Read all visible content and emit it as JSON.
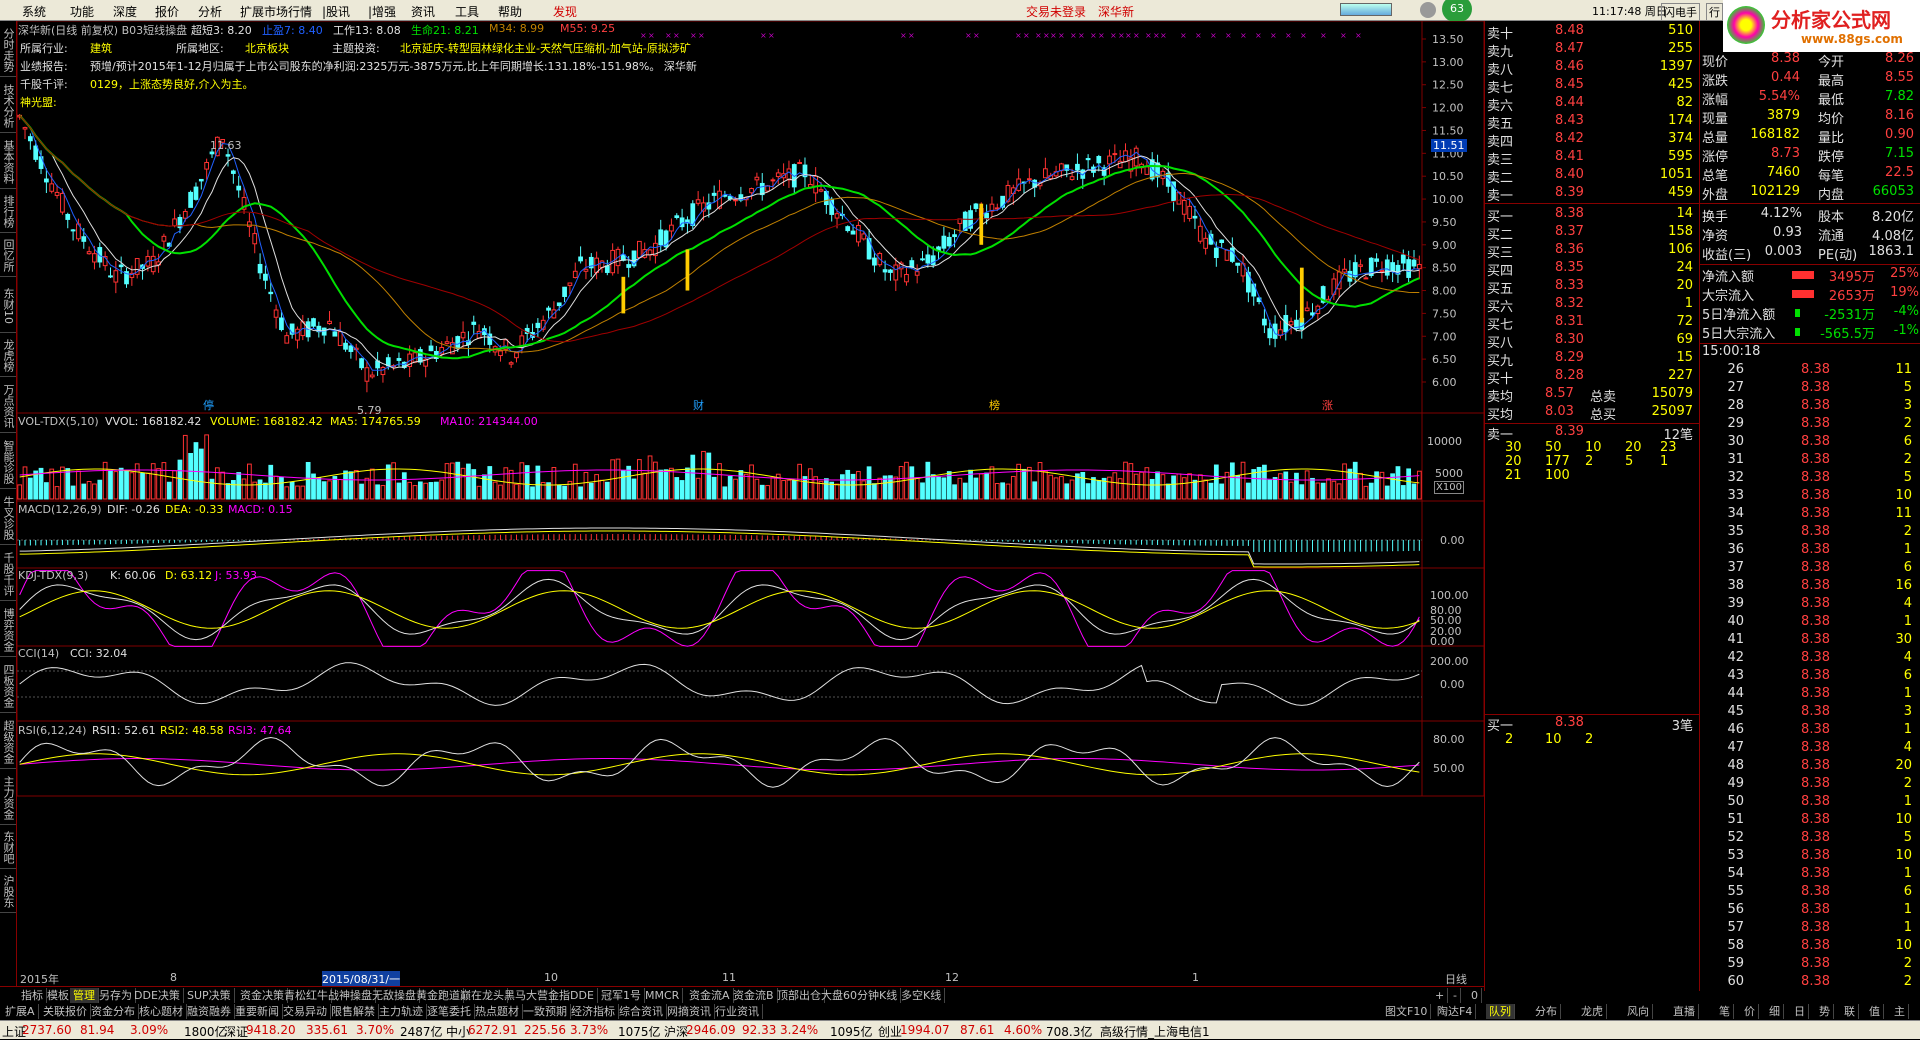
{
  "menu": [
    "系统",
    "功能",
    "深度",
    "报价",
    "分析",
    "扩展市场行情",
    "|股讯",
    "|增强",
    "资讯",
    "工具",
    "帮助",
    "发现"
  ],
  "login_text": "交易未登录",
  "login_stock": "深华新",
  "badge": "63",
  "clock": "11:17:48 周日",
  "server": "闪电手",
  "logo_text": "分析家公式网",
  "logo_url": "www.88gs.com",
  "chart_header": {
    "name": "深华新(日线 前复权) B03短线操盘",
    "c1": "超短3: 8.20",
    "c2": "止盈7: 8.40",
    "c3": "工作13: 8.08",
    "c4": "生命21: 8.21",
    "c5": "M34: 8.99",
    "c6": "M55: 9.25"
  },
  "info": {
    "industry_label": "所属行业:",
    "industry": "建筑",
    "region_label": "所属地区:",
    "region": "北京板块",
    "theme_label": "主题投资:",
    "theme": "北京延庆-转型园林绿化主业-天然气压缩机-加气站-原拟涉矿",
    "report_label": "业绩报告:",
    "report": "预增/预计2015年1-12月归属于上市公司股东的净利润:2325万元-3875万元,比上年同期增长:131.18%-151.98%。 深华新",
    "comment_label": "千股千评:",
    "comment": "0129，上涨态势良好,介入为主。",
    "alliance_label": "神光盟:"
  },
  "price_marks": {
    "high": "11.63",
    "low": "5.79",
    "current": "11.51"
  },
  "event_marks": [
    "停",
    "财",
    "榜",
    "涨"
  ],
  "price_axis": [
    "13.50",
    "13.00",
    "12.50",
    "12.00",
    "11.50",
    "11.00",
    "10.50",
    "10.00",
    "9.50",
    "9.00",
    "8.50",
    "8.00",
    "7.50",
    "7.00",
    "6.50",
    "6.00"
  ],
  "vol": {
    "title": "VOL-TDX(5,10)",
    "vvol": "VVOL: 168182.42",
    "volume": "VOLUME: 168182.42",
    "ma5": "MA5: 174765.59",
    "ma10": "MA10: 214344.00",
    "axis": [
      "10000",
      "5000"
    ],
    "unit": "X100"
  },
  "macd": {
    "title": "MACD(12,26,9)",
    "dif": "DIF: -0.26",
    "dea": "DEA: -0.33",
    "macd": "MACD: 0.15",
    "axis": "0.00"
  },
  "kdj": {
    "title": "KDJ-TDX(9,3)",
    "k": "K: 60.06",
    "d": "D: 63.12",
    "j": "J: 53.93",
    "axis": [
      "100.00",
      "80.00",
      "50.00",
      "20.00",
      "0.00"
    ]
  },
  "cci": {
    "title": "CCI(14)",
    "v": "CCI: 32.04",
    "axis": [
      "200.00",
      "0.00"
    ]
  },
  "rsi": {
    "title": "RSI(6,12,24)",
    "r1": "RSI1: 52.61",
    "r2": "RSI2: 48.58",
    "r3": "RSI3: 47.64",
    "axis": [
      "80.00",
      "50.00"
    ]
  },
  "date_axis": [
    "2015年",
    "8",
    "2015/08/31/一",
    "10",
    "11",
    "12",
    "1"
  ],
  "period": "日线",
  "left_tabs": [
    "分时走势",
    "技术分析",
    "基本资料",
    "排行榜",
    "回忆所",
    "东财10",
    "龙虎榜",
    "万点资讯",
    "智能诊股",
    "牛叉诊股",
    "千股千评",
    "博弈资金",
    "四板资金",
    "超级资金",
    "主力资金",
    "东财吧",
    "沪股东"
  ],
  "tabs1": [
    "指标",
    "模板",
    "管理",
    "另存为",
    "DDE决策",
    "SUP决策",
    "资金决策",
    "青松红牛",
    "战神操盘",
    "无敌操盘",
    "黄金跑道",
    "巅在龙头",
    "黑马大营",
    "金指DDE",
    "冠军1号",
    "MMCR",
    "资金流A",
    "资金流B",
    "顶部出仓",
    "大盘60分钟K线",
    "多空K线"
  ],
  "tabs2": [
    "扩展A",
    "关联报价",
    "资金分布",
    "核心题材",
    "融资融券",
    "重要新闻",
    "交易异动",
    "限售解禁",
    "主力轨迹",
    "逐笔委托",
    "热点题材",
    "一致预期",
    "经济指标",
    "综合资讯",
    "网摘资讯",
    "行业资讯"
  ],
  "tabs2_right": [
    "图文F10",
    "陶达F4"
  ],
  "ask": [
    [
      "卖十",
      "8.48",
      "510"
    ],
    [
      "卖九",
      "8.47",
      "255"
    ],
    [
      "卖八",
      "8.46",
      "1397"
    ],
    [
      "卖七",
      "8.45",
      "425"
    ],
    [
      "卖六",
      "8.44",
      "82"
    ],
    [
      "卖五",
      "8.43",
      "174"
    ],
    [
      "卖四",
      "8.42",
      "374"
    ],
    [
      "卖三",
      "8.41",
      "595"
    ],
    [
      "卖二",
      "8.40",
      "1051"
    ],
    [
      "卖一",
      "8.39",
      "459"
    ]
  ],
  "bid": [
    [
      "买一",
      "8.38",
      "14"
    ],
    [
      "买二",
      "8.37",
      "158"
    ],
    [
      "买三",
      "8.36",
      "106"
    ],
    [
      "买四",
      "8.35",
      "24"
    ],
    [
      "买五",
      "8.33",
      "20"
    ],
    [
      "买六",
      "8.32",
      "1"
    ],
    [
      "买七",
      "8.31",
      "72"
    ],
    [
      "买八",
      "8.30",
      "69"
    ],
    [
      "买九",
      "8.29",
      "15"
    ],
    [
      "买十",
      "8.28",
      "227"
    ]
  ],
  "avg": {
    "ask_avg_l": "卖均",
    "ask_avg": "8.57",
    "tot_ask_l": "总卖",
    "tot_ask": "15079",
    "bid_avg_l": "买均",
    "bid_avg": "8.03",
    "tot_bid_l": "总买",
    "tot_bid": "25097"
  },
  "queue_sell": {
    "label": "卖一",
    "price": "8.39",
    "count": "12笔",
    "row1": [
      "30",
      "50",
      "10",
      "20",
      "23"
    ],
    "row2": [
      "20",
      "177",
      "2",
      "5",
      "1"
    ],
    "row3": [
      "21",
      "100"
    ]
  },
  "queue_buy": {
    "label": "买一",
    "price": "8.38",
    "count": "3笔",
    "row1": [
      "2",
      "10",
      "2"
    ]
  },
  "stats": [
    [
      "现价",
      "8.38",
      "今开",
      "8.26"
    ],
    [
      "涨跌",
      "0.44",
      "最高",
      "8.55"
    ],
    [
      "涨幅",
      "5.54%",
      "最低",
      "7.82"
    ],
    [
      "现量",
      "3879",
      "均价",
      "8.16"
    ],
    [
      "总量",
      "168182",
      "量比",
      "0.90"
    ],
    [
      "涨停",
      "8.73",
      "跌停",
      "7.15"
    ],
    [
      "总笔",
      "7460",
      "每笔",
      "22.5"
    ],
    [
      "外盘",
      "102129",
      "内盘",
      "66053"
    ]
  ],
  "stats2": [
    [
      "换手",
      "4.12%",
      "股本",
      "8.20亿"
    ],
    [
      "净资",
      "0.93",
      "流通",
      "4.08亿"
    ],
    [
      "收益(三)",
      "0.003",
      "PE(动)",
      "1863.1"
    ]
  ],
  "flow": [
    [
      "净流入额",
      "3495万",
      "25%"
    ],
    [
      "大宗流入",
      "2653万",
      "19%"
    ],
    [
      "5日净流入额",
      "-2531万",
      "-4%"
    ],
    [
      "5日大宗流入",
      "-565.5万",
      "-1%"
    ]
  ],
  "ticks_start": "15:00:18",
  "ticks": [
    [
      "26",
      "8.38",
      "11"
    ],
    [
      "27",
      "8.38",
      "5"
    ],
    [
      "28",
      "8.38",
      "3"
    ],
    [
      "29",
      "8.38",
      "2"
    ],
    [
      "30",
      "8.38",
      "6"
    ],
    [
      "31",
      "8.38",
      "2"
    ],
    [
      "32",
      "8.38",
      "5"
    ],
    [
      "33",
      "8.38",
      "10"
    ],
    [
      "34",
      "8.38",
      "11"
    ],
    [
      "35",
      "8.38",
      "2"
    ],
    [
      "36",
      "8.38",
      "1"
    ],
    [
      "37",
      "8.38",
      "6"
    ],
    [
      "38",
      "8.38",
      "16"
    ],
    [
      "39",
      "8.38",
      "4"
    ],
    [
      "40",
      "8.38",
      "1"
    ],
    [
      "41",
      "8.38",
      "30"
    ],
    [
      "42",
      "8.38",
      "4"
    ],
    [
      "43",
      "8.38",
      "6"
    ],
    [
      "44",
      "8.38",
      "1"
    ],
    [
      "45",
      "8.38",
      "3"
    ],
    [
      "46",
      "8.38",
      "1"
    ],
    [
      "47",
      "8.38",
      "4"
    ],
    [
      "48",
      "8.38",
      "20"
    ],
    [
      "49",
      "8.38",
      "2"
    ],
    [
      "50",
      "8.38",
      "1"
    ],
    [
      "51",
      "8.38",
      "10"
    ],
    [
      "52",
      "8.38",
      "5"
    ],
    [
      "53",
      "8.38",
      "10"
    ],
    [
      "54",
      "8.38",
      "1"
    ],
    [
      "55",
      "8.38",
      "6"
    ],
    [
      "56",
      "8.38",
      "1"
    ],
    [
      "57",
      "8.38",
      "1"
    ],
    [
      "58",
      "8.38",
      "10"
    ],
    [
      "59",
      "8.38",
      "2"
    ],
    [
      "60",
      "8.38",
      "2"
    ]
  ],
  "rp_tabs": [
    "队列",
    "分布",
    "龙虎",
    "风向",
    "直播",
    "笔",
    "价",
    "细",
    "日",
    "势",
    "联",
    "值",
    "主"
  ],
  "status": {
    "sh_l": "上证",
    "sh": "2737.60",
    "sh_c": "81.94",
    "sh_p": "3.09%",
    "sh_v": "1800亿",
    "sz_l": "深证",
    "sz": "9418.20",
    "sz_c": "335.61",
    "sz_p": "3.70%",
    "sz_v": "2487亿",
    "zx_l": "中小",
    "zx": "6272.91",
    "zx_c": "225.56",
    "zx_p": "3.73%",
    "zx_v": "1075亿",
    "hs_l": "沪深",
    "hs": "2946.09",
    "hs_c": "92.33",
    "hs_p": "3.24%",
    "hs_v": "1095亿",
    "cy_l": "创业",
    "cy": "1994.07",
    "cy_c": "87.61",
    "cy_p": "4.60%",
    "cy_v": "708.3亿",
    "net": "高级行情_上海电信1"
  }
}
